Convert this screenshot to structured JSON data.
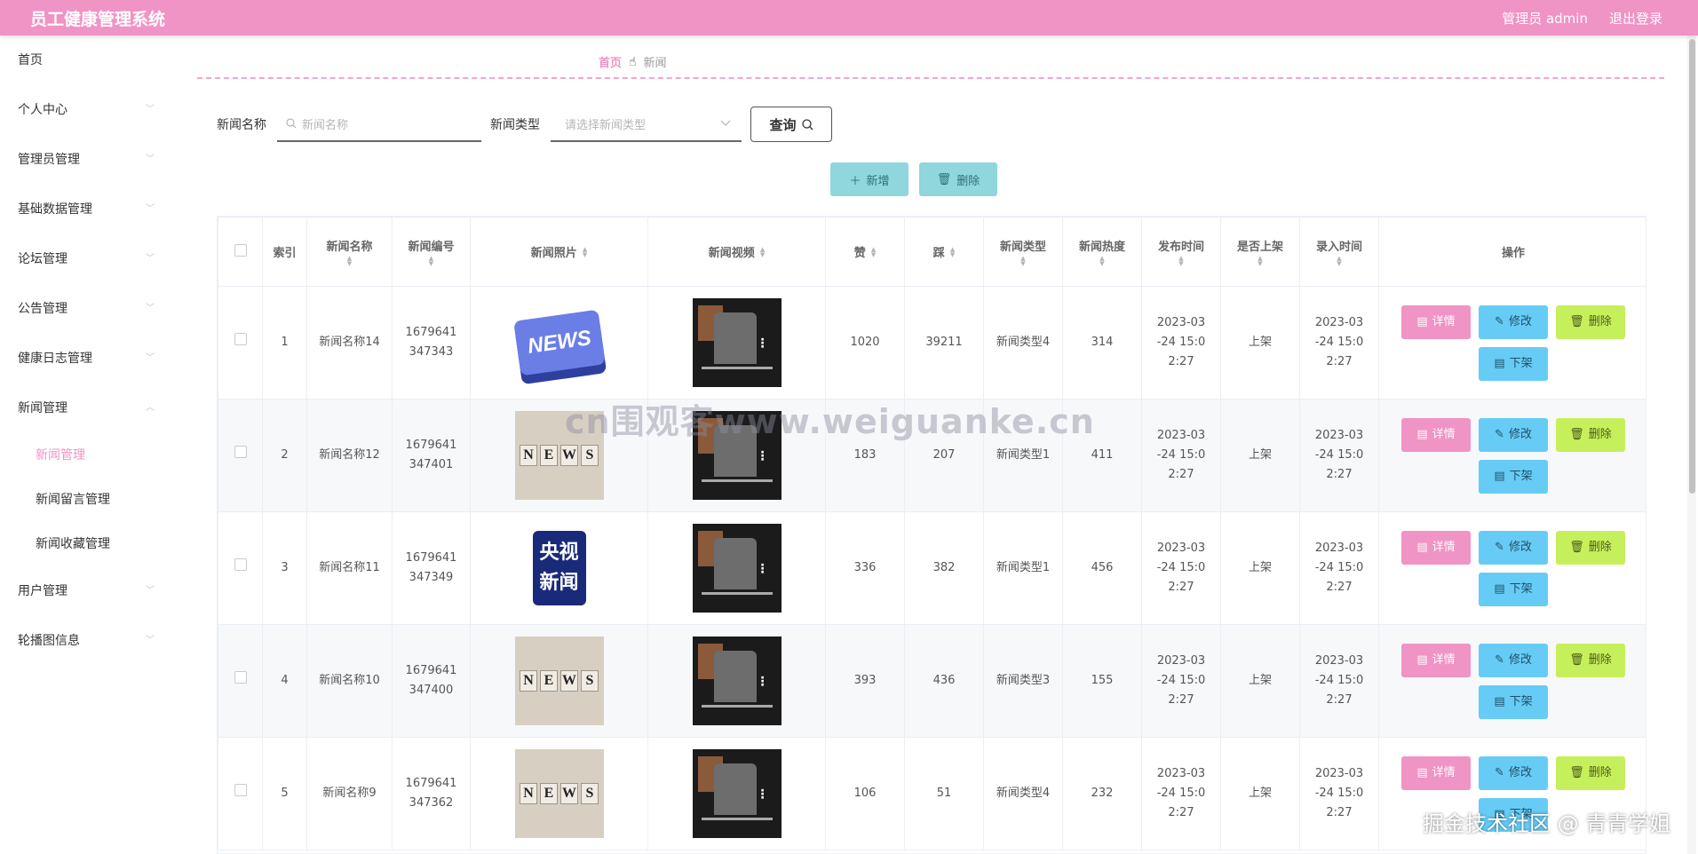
{
  "header": {
    "app_title": "员工健康管理系统",
    "admin_label": "管理员 admin",
    "logout_label": "退出登录"
  },
  "sidebar": {
    "items": [
      {
        "label": "首页",
        "icon": "none"
      },
      {
        "label": "个人中心",
        "icon": "chevron-down-icon"
      },
      {
        "label": "管理员管理",
        "icon": "chevron-down-icon"
      },
      {
        "label": "基础数据管理",
        "icon": "chevron-down-icon"
      },
      {
        "label": "论坛管理",
        "icon": "chevron-down-icon"
      },
      {
        "label": "公告管理",
        "icon": "chevron-down-icon"
      },
      {
        "label": "健康日志管理",
        "icon": "chevron-down-icon"
      },
      {
        "label": "新闻管理",
        "icon": "chevron-up-icon"
      },
      {
        "label": "用户管理",
        "icon": "chevron-down-icon"
      },
      {
        "label": "轮播图信息",
        "icon": "chevron-down-icon"
      }
    ],
    "news_submenu": [
      "新闻管理",
      "新闻留言管理",
      "新闻收藏管理"
    ]
  },
  "breadcrumb": {
    "home": "首页",
    "current": "新闻"
  },
  "search": {
    "name_label": "新闻名称",
    "name_placeholder": "新闻名称",
    "type_label": "新闻类型",
    "type_placeholder": "请选择新闻类型",
    "query_label": "查询"
  },
  "actions": {
    "add_label": "新增",
    "delete_label": "删除"
  },
  "table": {
    "headers": [
      "索引",
      "新闻名称",
      "新闻编号",
      "新闻照片",
      "新闻视频",
      "赞",
      "踩",
      "新闻类型",
      "新闻热度",
      "发布时间",
      "是否上架",
      "录入时间",
      "操作"
    ],
    "ops": {
      "detail": "详情",
      "edit": "修改",
      "delete": "删除",
      "offline": "下架"
    },
    "rows": [
      {
        "index": "1",
        "name": "新闻名称14",
        "code": "1679641347343",
        "photo": "news-keyboard",
        "likes": "1020",
        "dislikes": "39211",
        "type": "新闻类型4",
        "heat": "314",
        "publish": "2023-03-24 15:02:27",
        "on_shelf": "上架",
        "entry": "2023-03-24 15:02:27"
      },
      {
        "index": "2",
        "name": "新闻名称12",
        "code": "1679641347401",
        "photo": "news-cubes",
        "likes": "183",
        "dislikes": "207",
        "type": "新闻类型1",
        "heat": "411",
        "publish": "2023-03-24 15:02:27",
        "on_shelf": "上架",
        "entry": "2023-03-24 15:02:27"
      },
      {
        "index": "3",
        "name": "新闻名称11",
        "code": "1679641347349",
        "photo": "cctv-news",
        "likes": "336",
        "dislikes": "382",
        "type": "新闻类型1",
        "heat": "456",
        "publish": "2023-03-24 15:02:27",
        "on_shelf": "上架",
        "entry": "2023-03-24 15:02:27"
      },
      {
        "index": "4",
        "name": "新闻名称10",
        "code": "1679641347400",
        "photo": "news-cubes",
        "likes": "393",
        "dislikes": "436",
        "type": "新闻类型3",
        "heat": "155",
        "publish": "2023-03-24 15:02:27",
        "on_shelf": "上架",
        "entry": "2023-03-24 15:02:27"
      },
      {
        "index": "5",
        "name": "新闻名称9",
        "code": "1679641347362",
        "photo": "news-cubes",
        "likes": "106",
        "dislikes": "51",
        "type": "新闻类型4",
        "heat": "232",
        "publish": "2023-03-24 15:02:27",
        "on_shelf": "上架",
        "entry": "2023-03-24 15:02:27"
      }
    ]
  },
  "watermarks": {
    "center": "cn围观客www.weiguanke.cn",
    "corner": "掘金技术社区 @ 青青学姐"
  },
  "colors": {
    "brand_pink": "#f093c5",
    "action_teal": "#8fd6dd",
    "edit_blue": "#66ccf5",
    "delete_green": "#c6f05b"
  }
}
